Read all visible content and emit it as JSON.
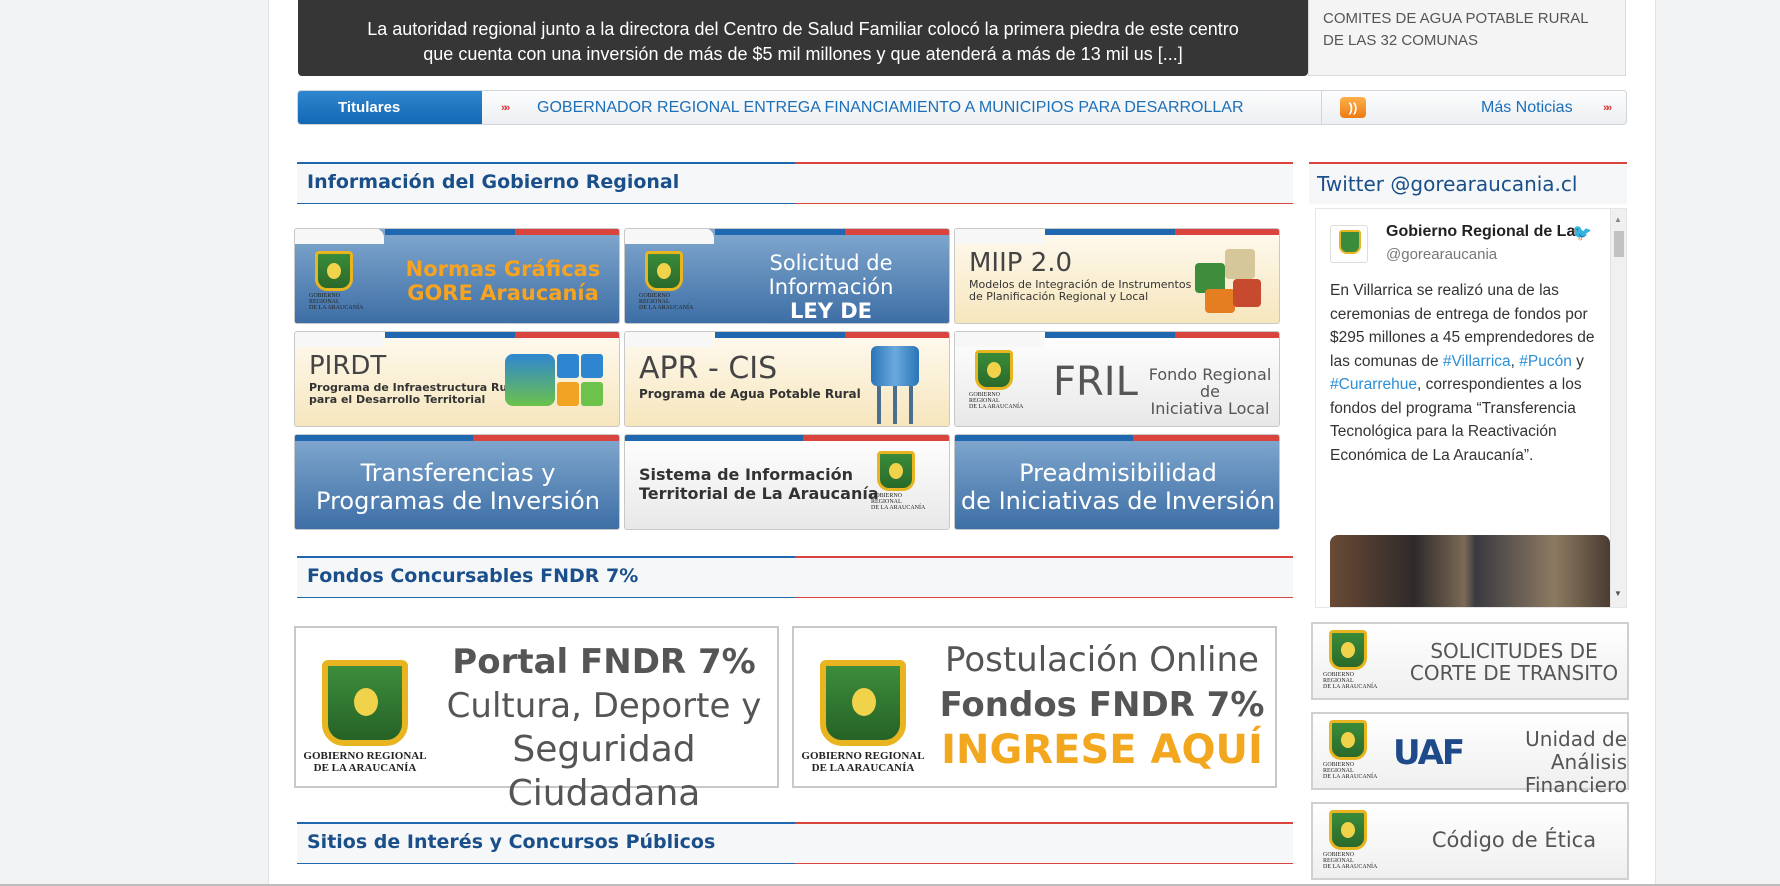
{
  "hero": {
    "line1": "La autoridad regional junto a la directora del Centro de Salud Familiar colocó la primera piedra de este centro",
    "line2": "que cuenta con una inversión de más de $5 mil millones y que atenderá a más de 13 mil us [...]",
    "side_text": "COMITES DE AGUA POTABLE RURAL DE LAS 32 COMUNAS"
  },
  "ticker": {
    "tab_label": "Titulares",
    "headline": "GOBERNADOR REGIONAL ENTREGA FINANCIAMIENTO A MUNICIPIOS PARA DESARROLLAR",
    "more_label": "Más Noticias",
    "arrow_glyph": "»»"
  },
  "sections": {
    "info": "Información del Gobierno Regional",
    "fndr": "Fondos Concursables FNDR 7%",
    "sitios": "Sitios de Interés y Concursos Públicos"
  },
  "logo_caption": {
    "line1": "GOBIERNO REGIONAL",
    "line2": "DE LA ARAUCANÍA"
  },
  "tiles": {
    "normas": {
      "title1": "Normas Gráficas",
      "title2": "GORE Araucanía"
    },
    "solicitud": {
      "title1": "Solicitud de Información",
      "title2": "LEY DE TRANSPARENCIA"
    },
    "miip": {
      "title": "MIIP 2.0",
      "sub1": "Modelos de Integración de Instrumentos",
      "sub2": "de Planificación Regional y Local"
    },
    "pirdt": {
      "title": "PIRDT",
      "sub1": "Programa de Infraestructura Rural",
      "sub2": "para el Desarrollo Territorial"
    },
    "apr": {
      "title": "APR - CIS",
      "sub": "Programa de Agua Potable Rural"
    },
    "fril": {
      "title": "FRIL",
      "sub1": "Fondo Regional de",
      "sub2": "Iniciativa Local"
    },
    "transferencias": {
      "title1": "Transferencias y",
      "title2": "Programas de Inversión"
    },
    "sistema": {
      "title1": "Sistema de Información",
      "title2": "Territorial de La Araucanía"
    },
    "preadm": {
      "title1": "Preadmisibilidad",
      "title2": "de Iniciativas de Inversión"
    }
  },
  "fndr_cards": {
    "portal": {
      "title": "Portal FNDR 7%",
      "line2": "Cultura, Deporte y",
      "line3": "Seguridad Ciudadana"
    },
    "postulacion": {
      "title": "Postulación Online",
      "line2": "Fondos FNDR 7%",
      "line3": "INGRESE AQUÍ"
    }
  },
  "twitter": {
    "header": "Twitter @gorearaucania.cl",
    "name": "Gobierno Regional de La",
    "handle": "@gorearaucania",
    "text_a": "En Villarrica se realizó una de las ceremonias de entrega de fondos por $295 millones a 45 emprendedores de las comunas de ",
    "tag1": "#Villarrica",
    "sep1": ", ",
    "tag2": "#Pucón",
    "sep2": " y ",
    "tag3": "#Curarrehue",
    "text_b": ", correspondientes a los fondos del programa “Transferencia Tecnológica para la Reactivación Económica de La Araucanía”."
  },
  "side_tiles": {
    "corte": {
      "line1": "SOLICITUDES DE",
      "line2": "CORTE DE TRANSITO"
    },
    "uaf": {
      "logo": "UAF",
      "line1": "Unidad de",
      "line2": "Análisis Financiero"
    },
    "etica": {
      "label": "Código de Ética"
    }
  },
  "colors": {
    "accent_blue": "#1f68b0",
    "accent_red": "#d9443f",
    "gold": "#e8b521",
    "link_blue": "#1d6fb8"
  }
}
